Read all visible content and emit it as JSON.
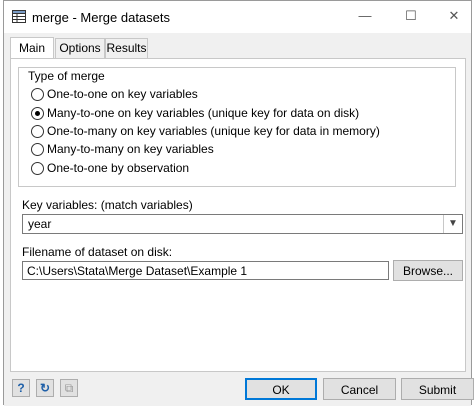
{
  "window": {
    "title": "merge - Merge datasets",
    "controls": {
      "minimize": "—",
      "maximize": "☐",
      "close": "✕"
    },
    "icon": "dataset-window-icon"
  },
  "tabs": [
    {
      "label": "Main",
      "active": true
    },
    {
      "label": "Options",
      "active": false
    },
    {
      "label": "Results",
      "active": false
    }
  ],
  "merge_type": {
    "legend": "Type of merge",
    "options": [
      {
        "label": "One-to-one on key variables",
        "checked": false
      },
      {
        "label": "Many-to-one on key variables (unique key for data on disk)",
        "checked": true
      },
      {
        "label": "One-to-many on key variables (unique key for data in memory)",
        "checked": false
      },
      {
        "label": "Many-to-many on key variables",
        "checked": false
      },
      {
        "label": "One-to-one by observation",
        "checked": false
      }
    ]
  },
  "key_variables": {
    "label": "Key variables: (match variables)",
    "value": "year"
  },
  "filename": {
    "label": "Filename of dataset on disk:",
    "value": "C:\\Users\\Stata\\Merge Dataset\\Example 1",
    "browse_label": "Browse..."
  },
  "footer": {
    "help_icon": "?",
    "reset_icon": "↻",
    "copy_icon": "⧉",
    "ok_label": "OK",
    "cancel_label": "Cancel",
    "submit_label": "Submit"
  }
}
